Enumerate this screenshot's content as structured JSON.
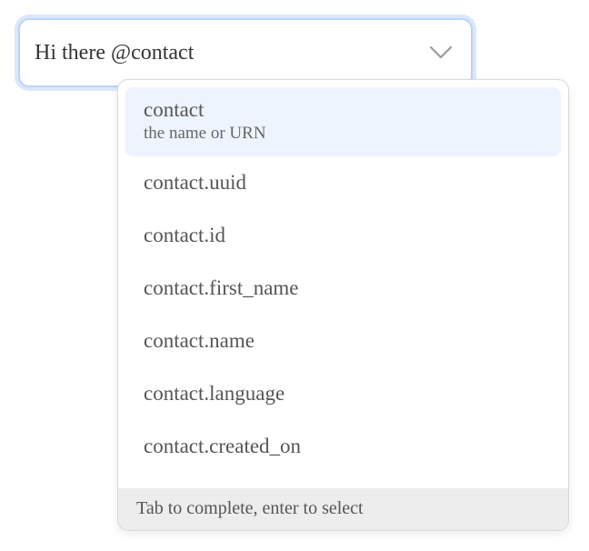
{
  "input": {
    "value": "Hi there @contact"
  },
  "icons": {
    "dropdown_toggle": "chevron-down-icon"
  },
  "colors": {
    "focus_ring": "#bcd3f7",
    "selected_option_bg": "#eef4fe",
    "footer_bg": "#ededed"
  },
  "dropdown": {
    "options": [
      {
        "label": "contact",
        "description": "the name or URN",
        "selected": true
      },
      {
        "label": "contact.uuid"
      },
      {
        "label": "contact.id"
      },
      {
        "label": "contact.first_name"
      },
      {
        "label": "contact.name"
      },
      {
        "label": "contact.language"
      },
      {
        "label": "contact.created_on"
      }
    ],
    "footer_hint": "Tab to complete, enter to select"
  }
}
